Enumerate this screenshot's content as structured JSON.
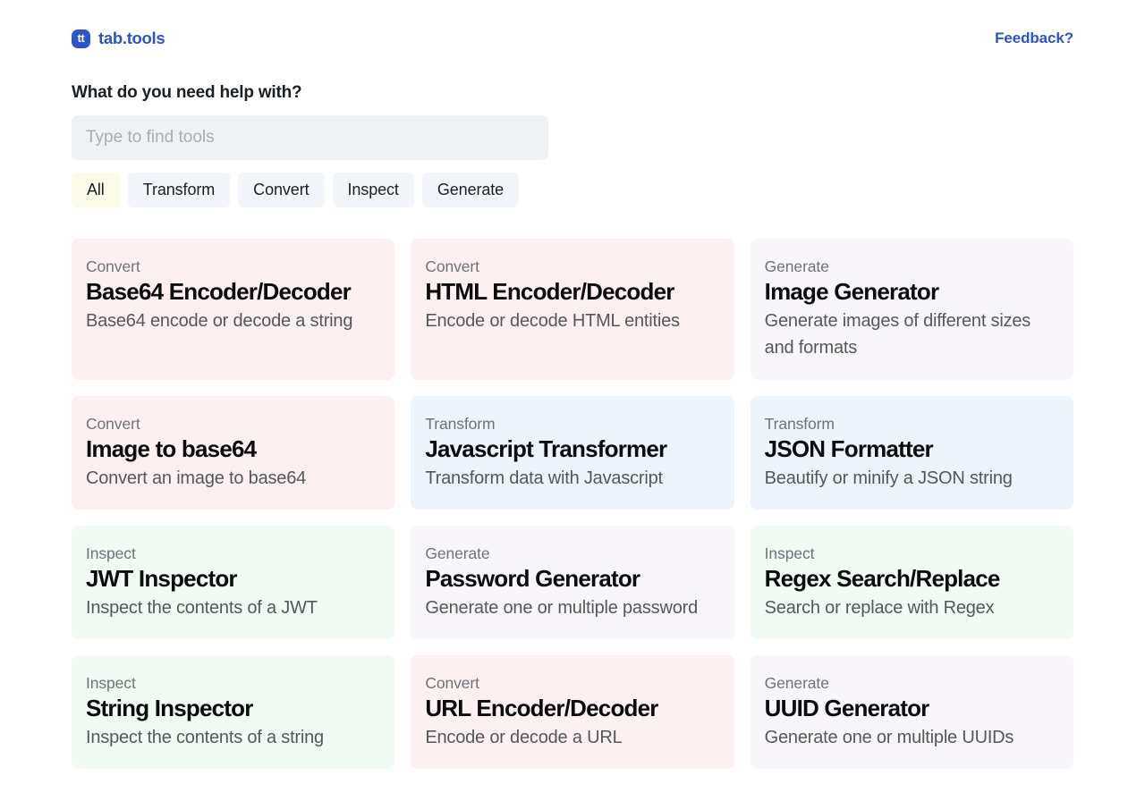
{
  "header": {
    "logo_text": "tt",
    "logo_icon": "tab-tools-logo-icon",
    "brand_name": "tab.tools",
    "feedback_label": "Feedback?",
    "brand_color": "#2c55c9"
  },
  "search": {
    "heading": "What do you need help with?",
    "placeholder": "Type to find tools",
    "value": ""
  },
  "filters": {
    "active": "All",
    "active_color": "#fcfbe7",
    "inactive_color": "#f2f6fa",
    "items": [
      {
        "label": "All"
      },
      {
        "label": "Transform"
      },
      {
        "label": "Convert"
      },
      {
        "label": "Inspect"
      },
      {
        "label": "Generate"
      }
    ]
  },
  "category_colors": {
    "Convert": "#fcf0f0",
    "Generate": "#f9f6fb",
    "Transform": "#eef4fc",
    "Inspect": "#f1faf3"
  },
  "tools": [
    {
      "category": "Convert",
      "title": "Base64 Encoder/Decoder",
      "description": "Base64 encode or decode a string"
    },
    {
      "category": "Convert",
      "title": "HTML Encoder/Decoder",
      "description": "Encode or decode HTML entities"
    },
    {
      "category": "Generate",
      "title": "Image Generator",
      "description": "Generate images of different sizes and formats"
    },
    {
      "category": "Convert",
      "title": "Image to base64",
      "description": "Convert an image to base64"
    },
    {
      "category": "Transform",
      "title": "Javascript Transformer",
      "description": "Transform data with Javascript"
    },
    {
      "category": "Transform",
      "title": "JSON Formatter",
      "description": "Beautify or minify a JSON string"
    },
    {
      "category": "Inspect",
      "title": "JWT Inspector",
      "description": "Inspect the contents of a JWT"
    },
    {
      "category": "Generate",
      "title": "Password Generator",
      "description": "Generate one or multiple password"
    },
    {
      "category": "Inspect",
      "title": "Regex Search/Replace",
      "description": "Search or replace with Regex"
    },
    {
      "category": "Inspect",
      "title": "String Inspector",
      "description": "Inspect the contents of a string"
    },
    {
      "category": "Convert",
      "title": "URL Encoder/Decoder",
      "description": "Encode or decode a URL"
    },
    {
      "category": "Generate",
      "title": "UUID Generator",
      "description": "Generate one or multiple UUIDs"
    }
  ]
}
